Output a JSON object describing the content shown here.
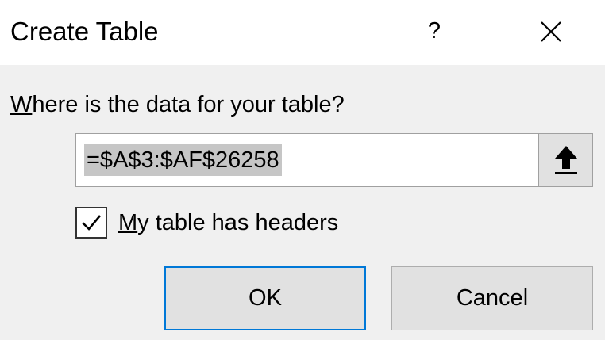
{
  "dialog": {
    "title": "Create Table",
    "help_label": "?",
    "close_icon": "close-icon"
  },
  "form": {
    "prompt_accel": "W",
    "prompt_rest": "here is the data for your table?",
    "range_value": "=$A$3:$AF$26258",
    "collapse_icon": "arrow-up-icon",
    "headers_checked": true,
    "headers_label_accel": "M",
    "headers_label_rest": "y table has headers"
  },
  "buttons": {
    "ok_label": "OK",
    "cancel_label": "Cancel"
  },
  "colors": {
    "title_bg": "#ffffff",
    "dialog_bg": "#f0f0f0",
    "selection_bg": "#c6c6c6",
    "default_button_border": "#0078d7",
    "button_bg": "#e1e1e1"
  }
}
